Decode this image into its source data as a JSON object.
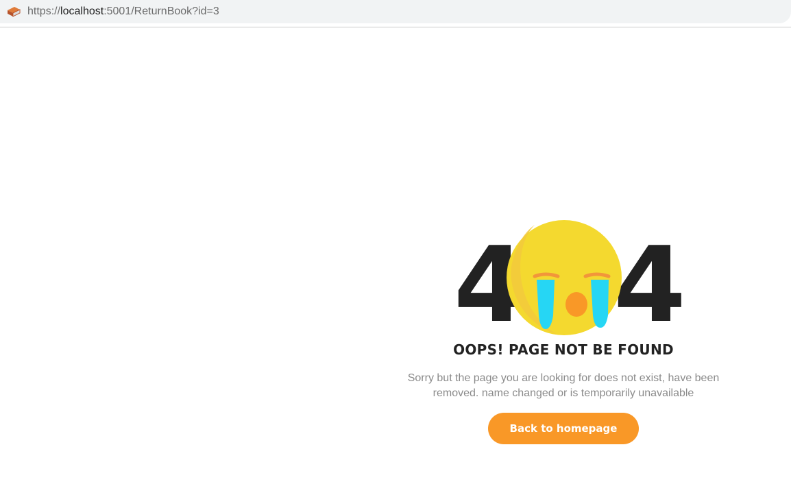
{
  "browser": {
    "url_scheme": "https://",
    "url_host": "localhost",
    "url_rest": ":5001/ReturnBook?id=3",
    "favicon": "book-icon"
  },
  "notfound": {
    "digit_left": "4",
    "digit_right": "4",
    "emoji": "crying-face-icon",
    "title": "OOPS! PAGE NOT BE FOUND",
    "description": "Sorry but the page you are looking for does not exist, have been removed. name changed or is temporarily unavailable",
    "button_label": "Back to homepage"
  },
  "colors": {
    "button": "#f99827",
    "emoji_face": "#f4d92f",
    "emoji_tears": "#26d6f4",
    "emoji_mouth": "#f99827",
    "text_dark": "#222222",
    "text_muted": "#8a8a8a"
  }
}
